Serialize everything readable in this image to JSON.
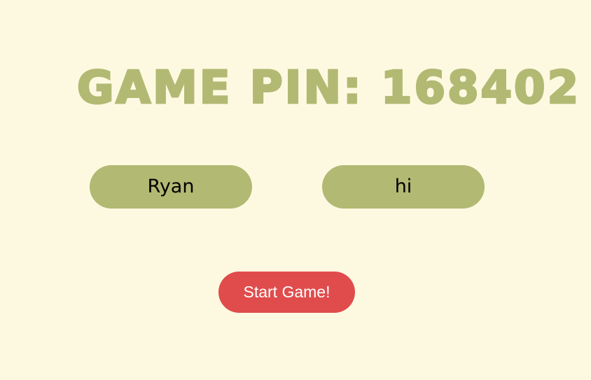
{
  "header": {
    "title": "GAME PIN: 168402"
  },
  "players": [
    {
      "name": "Ryan"
    },
    {
      "name": "hi"
    }
  ],
  "actions": {
    "start_label": "Start Game!"
  },
  "colors": {
    "background": "#fdf9e1",
    "accent_olive": "#b2b973",
    "start_button": "#e04c4c",
    "start_button_text": "#ffffff"
  }
}
